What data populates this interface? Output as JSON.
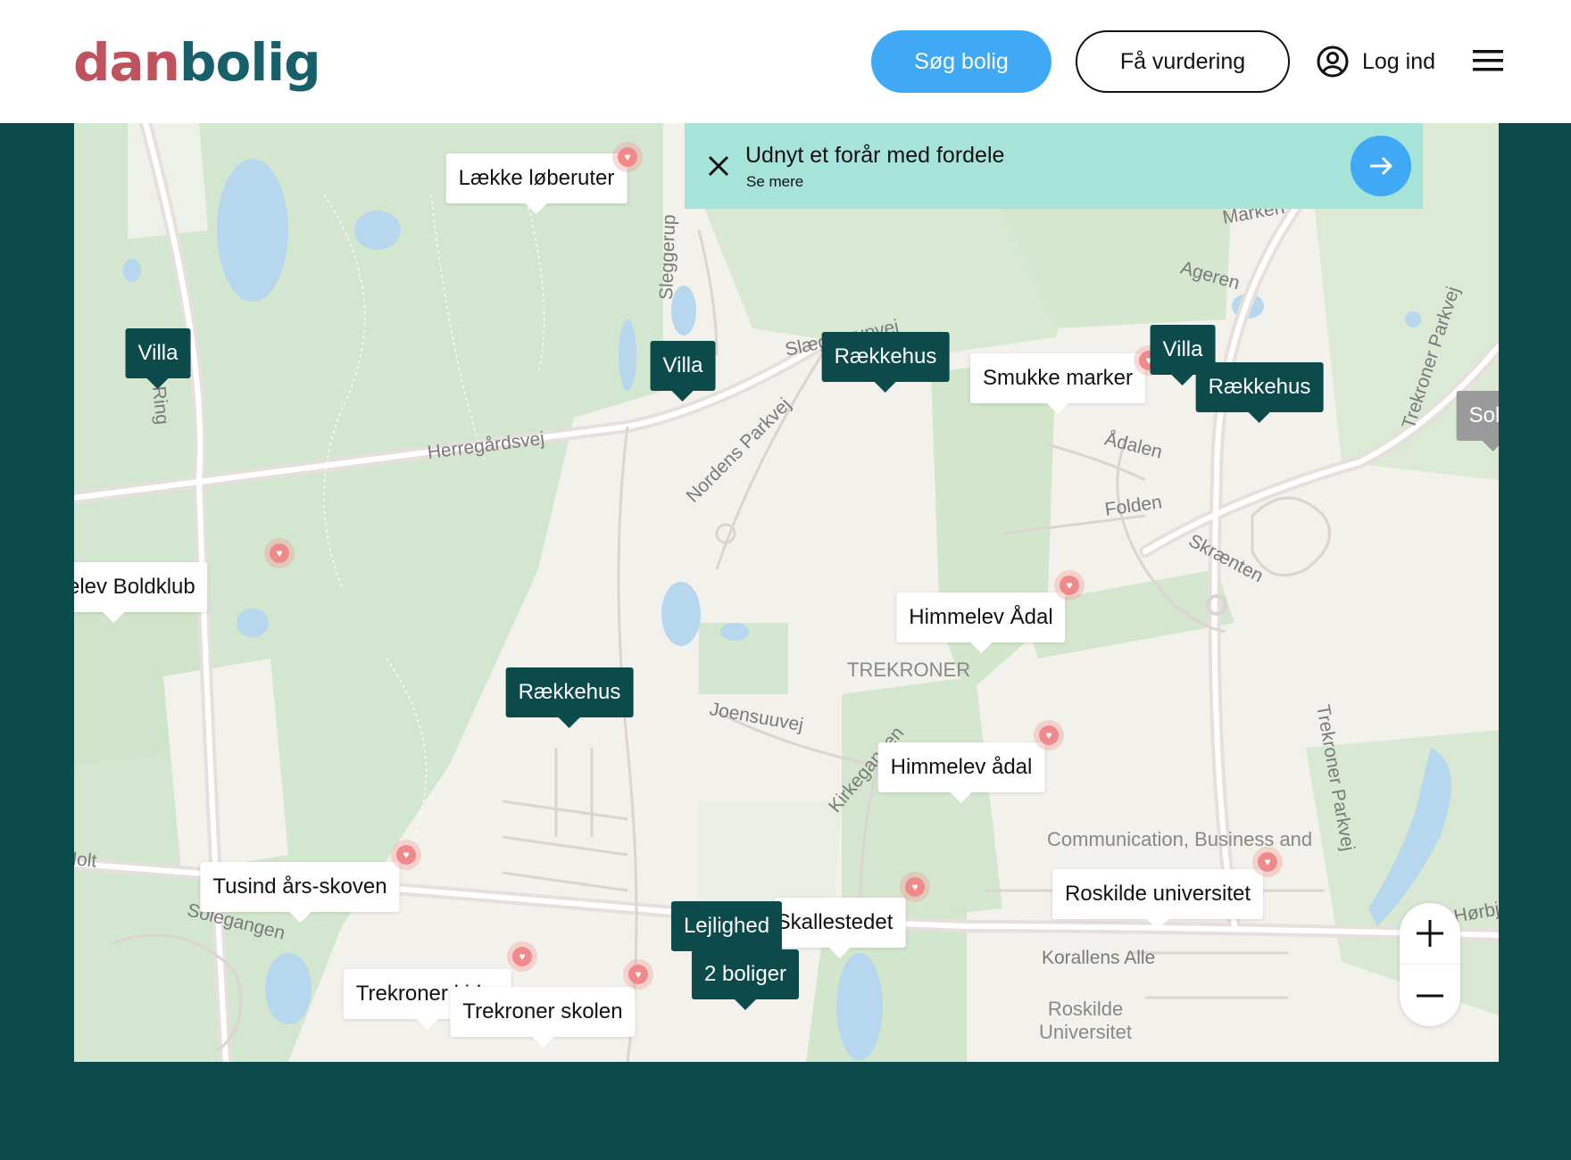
{
  "header": {
    "logo_part1": "dan",
    "logo_part2": "bolig",
    "search_label": "Søg bolig",
    "valuation_label": "Få vurdering",
    "login_label": "Log ind"
  },
  "promo": {
    "title": "Udnyt et forår med fordele",
    "link": "Se mere"
  },
  "map": {
    "streets": [
      "Østre Ring",
      "Sleggerup",
      "Slæggerupvej",
      "Marken",
      "Ageren",
      "Trekroner Parkvej",
      "Herregårdsvej",
      "Nordens Parkvej",
      "Ådalen",
      "Folden",
      "Skrænten",
      "Joensuuvej",
      "Kirkegangen",
      "Trekroner Parkvej",
      "Solegangen",
      "Korallens Alle",
      "Holt",
      "Hørbjerg"
    ],
    "areas": [
      "TREKRONER",
      "Communication, Business and",
      "Roskilde Universitet"
    ]
  },
  "markers": {
    "villa1": "Villa",
    "villa2": "Villa",
    "villa3": "Villa",
    "raekkehus1": "Rækkehus",
    "raekkehus2": "Rækkehus",
    "raekkehus3": "Rækkehus",
    "lejlighed": "Lejlighed",
    "boliger": "2 boliger",
    "sold": "Solgt"
  },
  "pois": {
    "loberuter": "Lække løberuter",
    "marker": "Smukke marker",
    "boldklub": "Veddelev Boldklub",
    "himmelev1": "Himmelev Ådal",
    "himmelev2": "Himmelev ådal",
    "skoven": "Tusind års-skoven",
    "kallestedet": "Skallestedet",
    "universitet": "Roskilde universitet",
    "trekroner1": "Trekroner kirke",
    "trekroner2": "Trekroner skolen"
  },
  "colors": {
    "brand_dark": "#0c4a4b",
    "accent_blue": "#3fa9f5",
    "promo_bg": "#a6e3d9",
    "logo_red": "#c0525d",
    "logo_teal": "#17606b",
    "favorite": "#f08a8a"
  }
}
